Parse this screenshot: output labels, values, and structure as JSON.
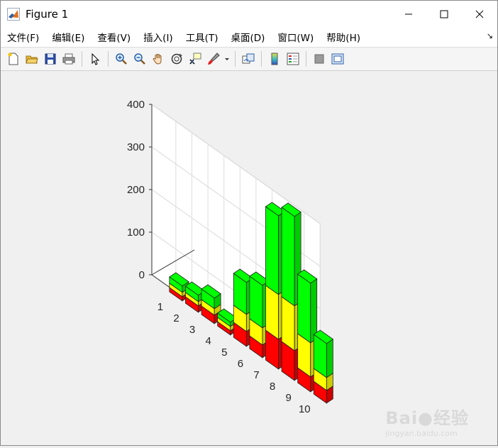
{
  "window": {
    "title": "Figure 1",
    "minimize_glyph": "—",
    "maximize_glyph": "☐",
    "close_glyph": "✕"
  },
  "menu": {
    "items": [
      "文件(F)",
      "编辑(E)",
      "查看(V)",
      "插入(I)",
      "工具(T)",
      "桌面(D)",
      "窗口(W)",
      "帮助(H)"
    ],
    "dock_arrow": "↘"
  },
  "toolbar": {
    "icons": [
      "new-figure-icon",
      "open-folder-icon",
      "save-icon",
      "print-icon",
      "pointer-icon",
      "zoom-in-icon",
      "zoom-out-icon",
      "pan-hand-icon",
      "rotate-3d-icon",
      "data-cursor-icon",
      "brush-icon",
      "link-plot-icon",
      "colorbar-icon",
      "legend-icon",
      "hide-plot-tools-icon",
      "show-plot-tools-icon"
    ]
  },
  "watermark": {
    "brand": "Bai●经验",
    "url": "jingyan.baidu.com"
  },
  "chart_data": {
    "type": "bar",
    "stacked": true,
    "three_d": true,
    "categories": [
      "1",
      "2",
      "3",
      "4",
      "5",
      "6",
      "7",
      "8",
      "9",
      "10"
    ],
    "series": [
      {
        "color": "#ff0000",
        "values": [
          10,
          15,
          20,
          10,
          35,
          30,
          70,
          70,
          35,
          30
        ]
      },
      {
        "color": "#ffff00",
        "values": [
          10,
          10,
          15,
          10,
          40,
          40,
          105,
          105,
          80,
          30
        ]
      },
      {
        "color": "#00ff00",
        "values": [
          15,
          15,
          25,
          10,
          75,
          100,
          185,
          210,
          140,
          80
        ]
      }
    ],
    "z_ticks": [
      "0",
      "100",
      "200",
      "300",
      "400"
    ],
    "zlim": [
      0,
      400
    ],
    "grid": true
  }
}
